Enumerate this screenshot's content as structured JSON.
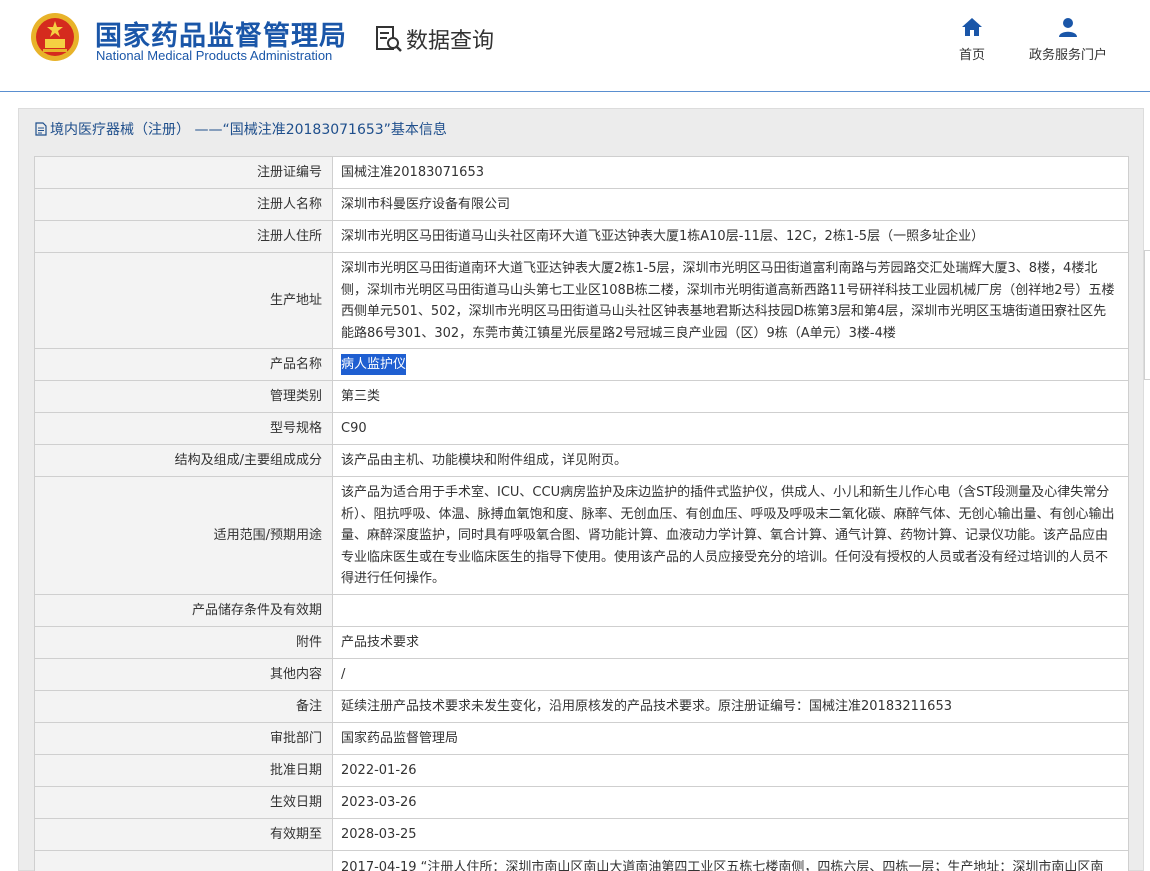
{
  "header": {
    "logo_cn": "国家药品监督管理局",
    "logo_en": "National Medical Products Administration",
    "query_label": "数据查询",
    "nav": [
      {
        "label": "首页",
        "icon": "home-icon"
      },
      {
        "label": "政务服务门户",
        "icon": "user-icon"
      }
    ]
  },
  "panel": {
    "title": "境内医疗器械（注册） ——“国械注准20183071653”基本信息"
  },
  "table": {
    "rows": [
      {
        "label": "注册证编号",
        "value": "国械注准20183071653"
      },
      {
        "label": "注册人名称",
        "value": "深圳市科曼医疗设备有限公司"
      },
      {
        "label": "注册人住所",
        "value": "深圳市光明区马田街道马山头社区南环大道飞亚达钟表大厦1栋A10层-11层、12C，2栋1-5层（一照多址企业）"
      },
      {
        "label": "生产地址",
        "value": "深圳市光明区马田街道南环大道飞亚达钟表大厦2栋1-5层，深圳市光明区马田街道富利南路与芳园路交汇处瑞辉大厦3、8楼，4楼北侧，深圳市光明区马田街道马山头第七工业区108B栋二楼，深圳市光明街道高新西路11号研祥科技工业园机械厂房（创祥地2号）五楼西侧单元501、502，深圳市光明区马田街道马山头社区钟表基地君斯达科技园D栋第3层和第4层，深圳市光明区玉塘街道田寮社区先能路86号301、302，东莞市黄江镇星光辰星路2号冠城三良产业园（区）9栋（A单元）3楼-4楼"
      },
      {
        "label": "产品名称",
        "value": "病人监护仪"
      },
      {
        "label": "管理类别",
        "value": "第三类"
      },
      {
        "label": "型号规格",
        "value": "C90"
      },
      {
        "label": "结构及组成/主要组成成分",
        "value": "该产品由主机、功能模块和附件组成，详见附页。"
      },
      {
        "label": "适用范围/预期用途",
        "value": "该产品为适合用于手术室、ICU、CCU病房监护及床边监护的插件式监护仪，供成人、小儿和新生儿作心电（含ST段测量及心律失常分析）、阻抗呼吸、体温、脉搏血氧饱和度、脉率、无创血压、有创血压、呼吸及呼吸末二氧化碳、麻醉气体、无创心输出量、有创心输出量、麻醉深度监护，同时具有呼吸氧合图、肾功能计算、血液动力学计算、氧合计算、通气计算、药物计算、记录仪功能。该产品应由专业临床医生或在专业临床医生的指导下使用。使用该产品的人员应接受充分的培训。任何没有授权的人员或者没有经过培训的人员不得进行任何操作。"
      },
      {
        "label": "产品储存条件及有效期",
        "value": ""
      },
      {
        "label": "附件",
        "value": "产品技术要求"
      },
      {
        "label": "其他内容",
        "value": "/"
      },
      {
        "label": "备注",
        "value": "延续注册产品技术要求未发生变化，沿用原核发的产品技术要求。原注册证编号：国械注准20183211653"
      },
      {
        "label": "审批部门",
        "value": "国家药品监督管理局"
      },
      {
        "label": "批准日期",
        "value": "2022-01-26"
      },
      {
        "label": "生效日期",
        "value": "2023-03-26"
      },
      {
        "label": "有效期至",
        "value": "2028-03-25"
      },
      {
        "label": "",
        "value": "2017-04-19  “注册人住所：深圳市南山区南山大道南油第四工业区五栋七楼南侧，四栋六层、四栋一层；生产地址：深圳市南山区南"
      }
    ]
  },
  "colors": {
    "brand_blue": "#1a56a8",
    "selection": "#1f5fd1",
    "label_bg": "#f3f3f3",
    "panel_bg": "#ececec"
  }
}
